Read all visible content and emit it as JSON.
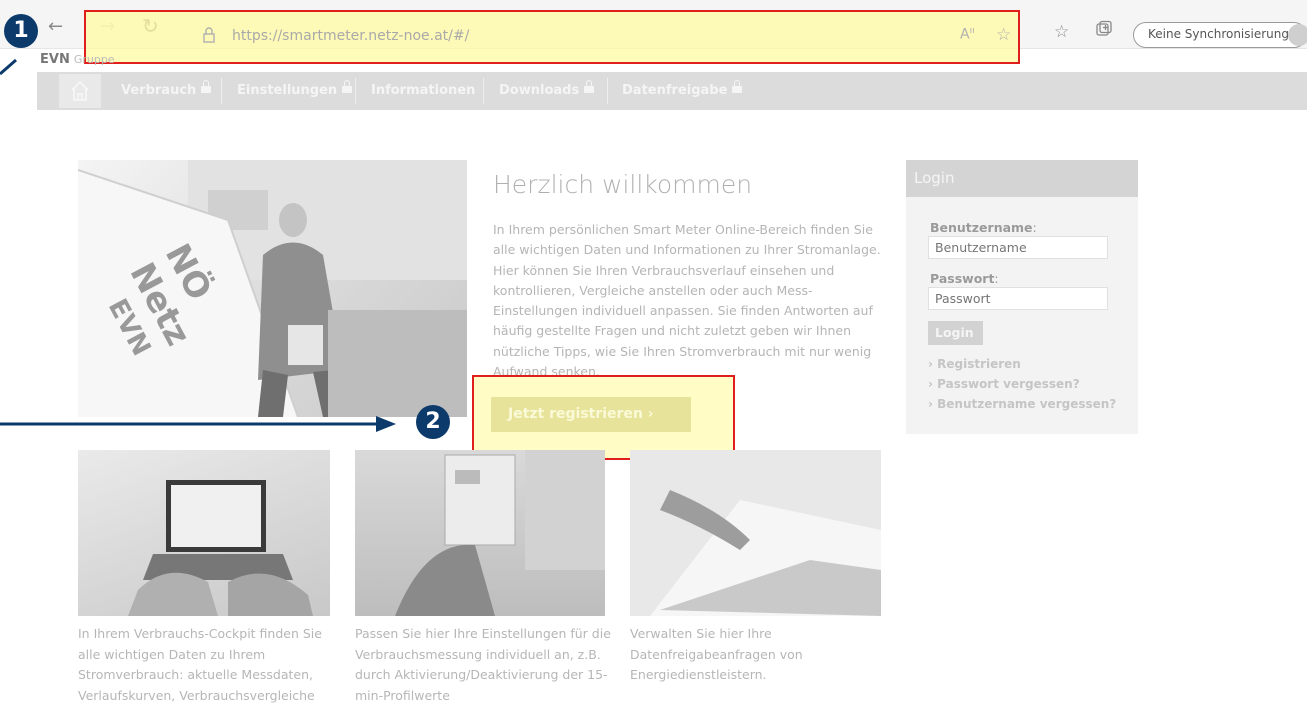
{
  "browser": {
    "url": "https://smartmeter.netz-noe.at/#/",
    "sync_label": "Keine Synchronisierung",
    "icons": [
      "back-icon",
      "forward-icon",
      "refresh-icon",
      "lock-icon",
      "read-aloud-icon",
      "add-favorite-icon",
      "favorites-icon",
      "collections-icon",
      "profile-icon"
    ]
  },
  "site": {
    "brand": "EVN",
    "brand_sub": "Gruppe",
    "nav": {
      "items": [
        {
          "label": "Verbrauch",
          "locked": true
        },
        {
          "label": "Einstellungen",
          "locked": true
        },
        {
          "label": "Informationen",
          "locked": false
        },
        {
          "label": "Downloads",
          "locked": true
        },
        {
          "label": "Datenfreigabe",
          "locked": true
        }
      ]
    },
    "welcome": {
      "title": "Herzlich willkommen",
      "text": "In Ihrem persönlichen Smart Meter Online-Bereich finden Sie alle wichtigen Daten und Informationen zu Ihrer Stromanlage. Hier können Sie Ihren Verbrauchsverlauf einsehen und kontrollieren, Vergleiche anstellen oder auch Mess-Einstellungen individuell anpassen. Sie finden Antworten auf häufig gestellte Fragen und nicht zuletzt geben wir Ihnen nützliche Tipps, wie Sie Ihren Stromverbrauch mit nur wenig Aufwand senken.",
      "register_button": "Jetzt registrieren ›"
    },
    "login": {
      "heading": "Login",
      "username_label": "Benutzername",
      "username_placeholder": "Benutzername",
      "password_label": "Passwort",
      "password_placeholder": "Passwort",
      "colon": ":",
      "button": "Login",
      "links": [
        "› Registrieren",
        "› Passwort vergessen?",
        "› Benutzername vergessen?"
      ]
    },
    "features": [
      {
        "caption": "In Ihrem Verbrauchs-Cockpit finden Sie alle wichtigen Daten zu Ihrem Stromverbrauch: aktuelle Messdaten, Verlaufskurven, Verbrauchsvergleiche"
      },
      {
        "caption": "Passen Sie hier Ihre Einstellungen für die Verbrauchsmessung individuell an, z.B. durch Aktivierung/Deaktivierung der 15-min-Profilwerte"
      },
      {
        "caption": "Verwalten Sie hier Ihre Datenfreigabeanfragen von Energiedienstleistern."
      }
    ],
    "hero_van_text": [
      "NÖ",
      "Netz",
      "EVN"
    ]
  },
  "annotations": {
    "badge_1": "1",
    "badge_2": "2",
    "highlight_color": "#fff7a0",
    "frame_color": "#e01e1e",
    "badge_color": "#0b3a6b"
  }
}
